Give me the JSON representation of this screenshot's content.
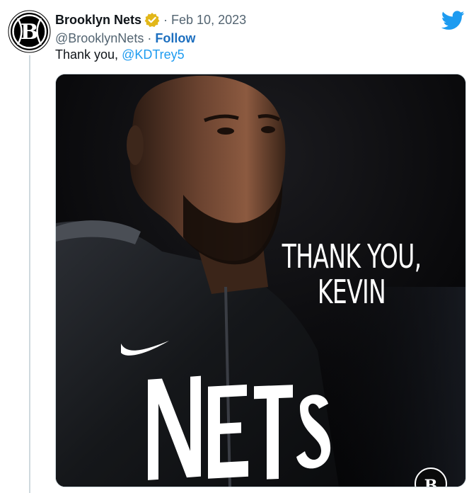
{
  "tweet": {
    "author_name": "Brooklyn Nets",
    "separator": "·",
    "date": "Feb 10, 2023",
    "handle": "@BrooklynNets",
    "handle_separator": "·",
    "follow_label": "Follow",
    "text_before_mention": "Thank you, ",
    "mention": "@KDTrey5"
  },
  "media": {
    "overlay_line1": "THANK YOU,",
    "overlay_line2": "KEVIN",
    "jersey_text": "NETS"
  },
  "icons": {
    "avatar": "brooklyn-nets-logo",
    "verified": "verified-badge-icon",
    "brand": "twitter-bird-icon",
    "swoosh": "nike-swoosh-logo"
  },
  "colors": {
    "link": "#1d9bf0",
    "follow": "#1d6fbf",
    "verified_gold": "#e2b719",
    "text_primary": "#0f1419",
    "text_secondary": "#536471",
    "thread_line": "#cfd9de"
  }
}
